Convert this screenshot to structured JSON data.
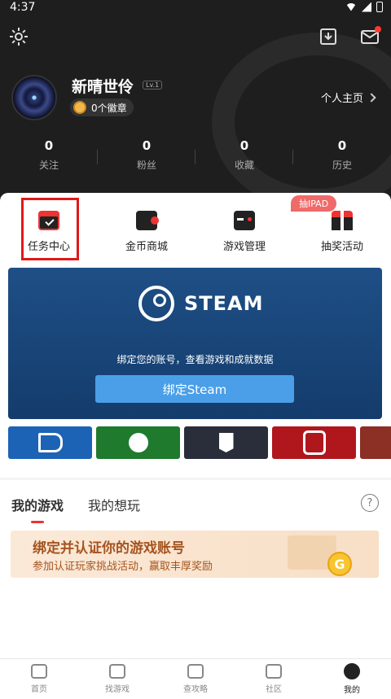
{
  "status_bar": {
    "time": "4:37"
  },
  "profile": {
    "username": "新晴世伶",
    "level": "Lv.1",
    "badges": "0个徽章",
    "homepage_link": "个人主页"
  },
  "stats": [
    {
      "value": "0",
      "label": "关注"
    },
    {
      "value": "0",
      "label": "粉丝"
    },
    {
      "value": "0",
      "label": "收藏"
    },
    {
      "value": "0",
      "label": "历史"
    }
  ],
  "quick_actions": [
    {
      "label": "任务中心",
      "icon": "calendar-check-icon"
    },
    {
      "label": "金币商城",
      "icon": "wallet-icon"
    },
    {
      "label": "游戏管理",
      "icon": "gamepad-icon"
    },
    {
      "label": "抽奖活动",
      "icon": "gift-icon"
    }
  ],
  "lottery_tag": "抽IPAD",
  "steam": {
    "logo_text": "STEAM",
    "description": "绑定您的账号，查看游戏和成就数据",
    "button": "绑定Steam"
  },
  "platforms": [
    "playstation",
    "xbox",
    "epic-games",
    "nintendo-switch"
  ],
  "games": {
    "tabs": [
      "我的游戏",
      "我的想玩"
    ],
    "banner_title": "绑定并认证你的游戏账号",
    "banner_subtitle": "参加认证玩家挑战活动，赢取丰厚奖励",
    "coin": "G"
  },
  "tabbar": [
    {
      "label": "首页",
      "icon": "home-icon"
    },
    {
      "label": "找游戏",
      "icon": "gamepad-icon"
    },
    {
      "label": "查攻略",
      "icon": "guide-icon"
    },
    {
      "label": "社区",
      "icon": "chat-icon"
    },
    {
      "label": "我的",
      "icon": "profile-icon"
    }
  ],
  "colors": {
    "accent": "#e33333",
    "steam_bg": "#1e4f86",
    "banner_text": "#a5541f"
  }
}
